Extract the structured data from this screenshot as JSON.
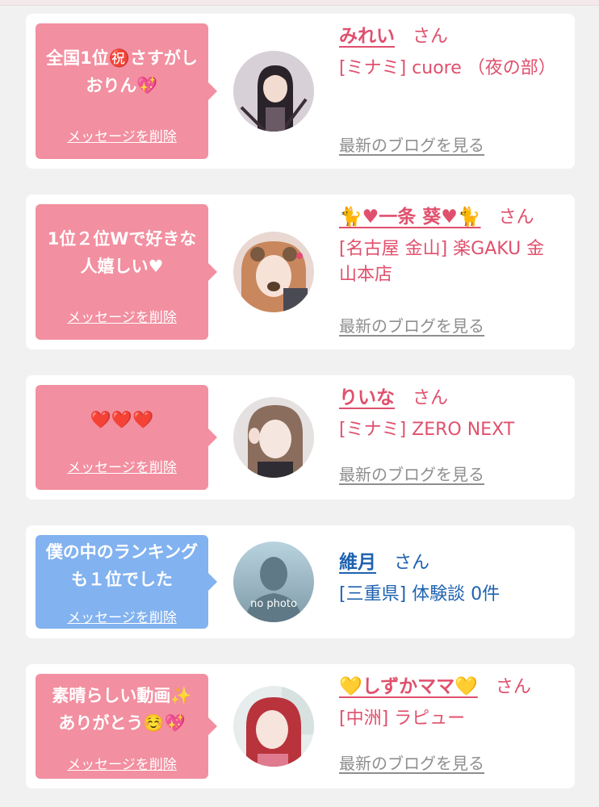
{
  "cards": [
    {
      "message": "全国1位㊗️さすがしおりん💖",
      "delete_label": "メッセージを削除",
      "name": "みれい",
      "honorific": "さん",
      "shop": "[ミナミ] cuore （夜の部）",
      "blog_label": "最新のブログを見る"
    },
    {
      "message": "1位２位Wで好きな人嬉しい♥",
      "delete_label": "メッセージを削除",
      "name": "🐈♥一条 葵♥🐈",
      "honorific": "さん",
      "shop": "[名古屋 金山] 楽GAKU 金山本店",
      "blog_label": "最新のブログを見る"
    },
    {
      "message": "❤️❤️❤️",
      "delete_label": "メッセージを削除",
      "name": "りいな",
      "honorific": "さん",
      "shop": "[ミナミ] ZERO NEXT",
      "blog_label": "最新のブログを見る"
    },
    {
      "message": "僕の中のランキングも１位でした",
      "delete_label": "メッセージを削除",
      "name": "維月",
      "honorific": "さん",
      "shop": "[三重県] 体験談 0件",
      "avatar_text": "no photo"
    },
    {
      "message": "素晴らしい動画✨ありがとう☺️💖",
      "delete_label": "メッセージを削除",
      "name": "💛しずかママ💛",
      "honorific": "さん",
      "shop": "[中洲] ラピュー",
      "blog_label": "最新のブログを見る"
    }
  ],
  "colors": {
    "pink_bubble": "#f28fa0",
    "blue_bubble": "#82b2ef",
    "pink_text": "#e0506d",
    "blue_text": "#1e62b0"
  }
}
